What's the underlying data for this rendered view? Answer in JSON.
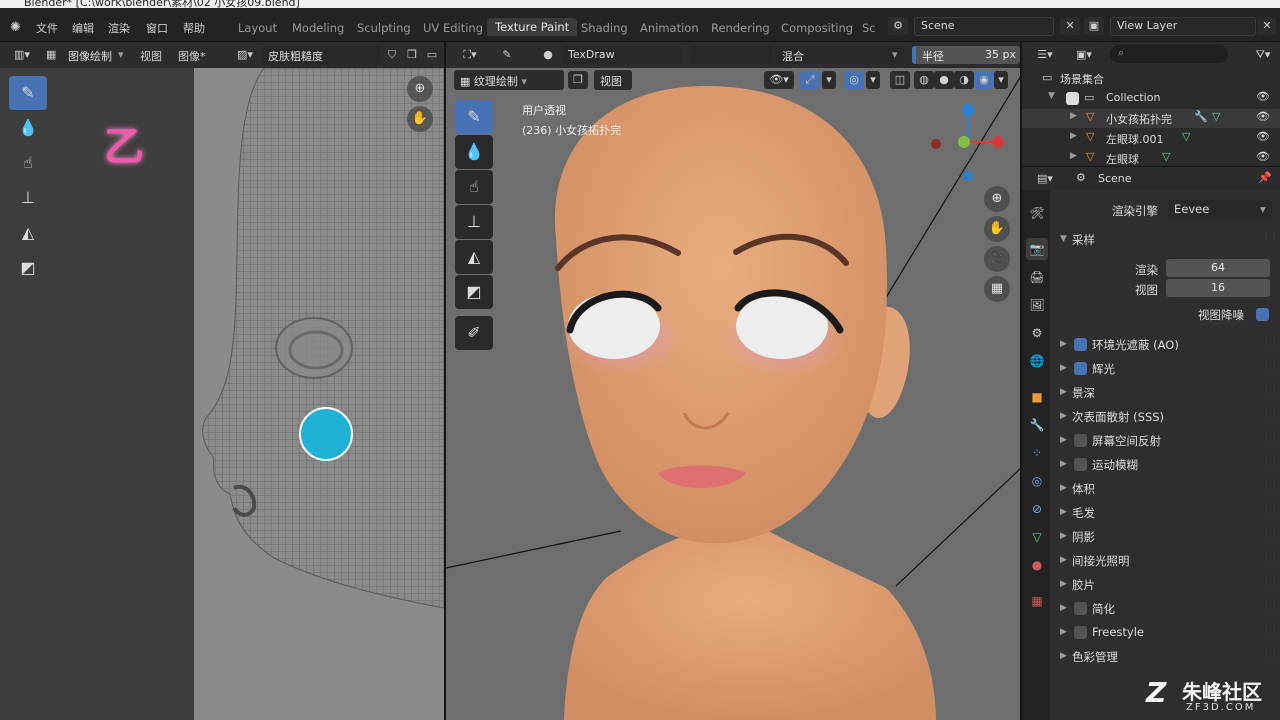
{
  "window": {
    "title": "Blender* [C:\\work\\blender\\素材\\02 小女孩09.blend]"
  },
  "menu": {
    "file": "文件",
    "edit": "编辑",
    "render": "渲染",
    "window": "窗口",
    "help": "帮助"
  },
  "workspace_tabs": [
    "Layout",
    "Modeling",
    "Sculpting",
    "UV Editing",
    "Texture Paint",
    "Shading",
    "Animation",
    "Rendering",
    "Compositing",
    "Sc"
  ],
  "active_workspace": "Texture Paint",
  "scene_selector": {
    "value": "Scene"
  },
  "view_layer_selector": {
    "value": "View Layer"
  },
  "image_editor": {
    "mode": "图像绘制",
    "view_menu": "视图",
    "image_menu": "图像*",
    "image_name": "皮肤粗糙度",
    "annotation": "乙"
  },
  "viewport_header": {
    "brush_name": "TexDraw",
    "blend_mode": "混合",
    "radius_label": "半径",
    "radius_value": "35 px"
  },
  "viewport": {
    "mode": "纹理绘制",
    "view_menu": "视图",
    "overlay_title": "用户透视",
    "overlay_object": "(236) 小女孩拓扑完"
  },
  "outliner": {
    "root": "场景集合",
    "items": [
      {
        "label": "Collection"
      },
      {
        "label": "小女孩拓扑完"
      },
      {
        "label": "左眼球.001"
      },
      {
        "label": "左眼球"
      }
    ]
  },
  "properties": {
    "header": "Scene",
    "render_engine_label": "渲染引擎",
    "render_engine_value": "Eevee",
    "sampling_label": "采样",
    "render_samples_label": "渲染",
    "render_samples_value": "64",
    "viewport_samples_label": "视图",
    "viewport_samples_value": "16",
    "viewport_denoise_label": "视图降噪",
    "panels": [
      {
        "label": "环境光遮蔽 (AO)",
        "checkbox": true,
        "checked": true
      },
      {
        "label": "辉光",
        "checkbox": true,
        "checked": true
      },
      {
        "label": "景深",
        "checkbox": false
      },
      {
        "label": "次表面散射 (SSS)",
        "checkbox": false
      },
      {
        "label": "屏幕空间反射",
        "checkbox": true,
        "checked": false
      },
      {
        "label": "运动模糊",
        "checkbox": true,
        "checked": false
      },
      {
        "label": "体积",
        "checkbox": false
      },
      {
        "label": "毛发",
        "checkbox": false
      },
      {
        "label": "阴影",
        "checkbox": false
      },
      {
        "label": "间接光照明",
        "checkbox": false
      },
      {
        "label": "胶片",
        "checkbox": false
      },
      {
        "label": "简化",
        "checkbox": true,
        "checked": false
      },
      {
        "label": "Freestyle",
        "checkbox": true,
        "checked": false
      },
      {
        "label": "色彩管理",
        "checkbox": false
      }
    ]
  },
  "watermark": {
    "text": "朱峰社区",
    "url": "ZF3D.COM"
  },
  "colors": {
    "accent": "#4772b3",
    "brush_cyan": "#1fb2d6",
    "annotation_pink": "#f05aa8"
  }
}
